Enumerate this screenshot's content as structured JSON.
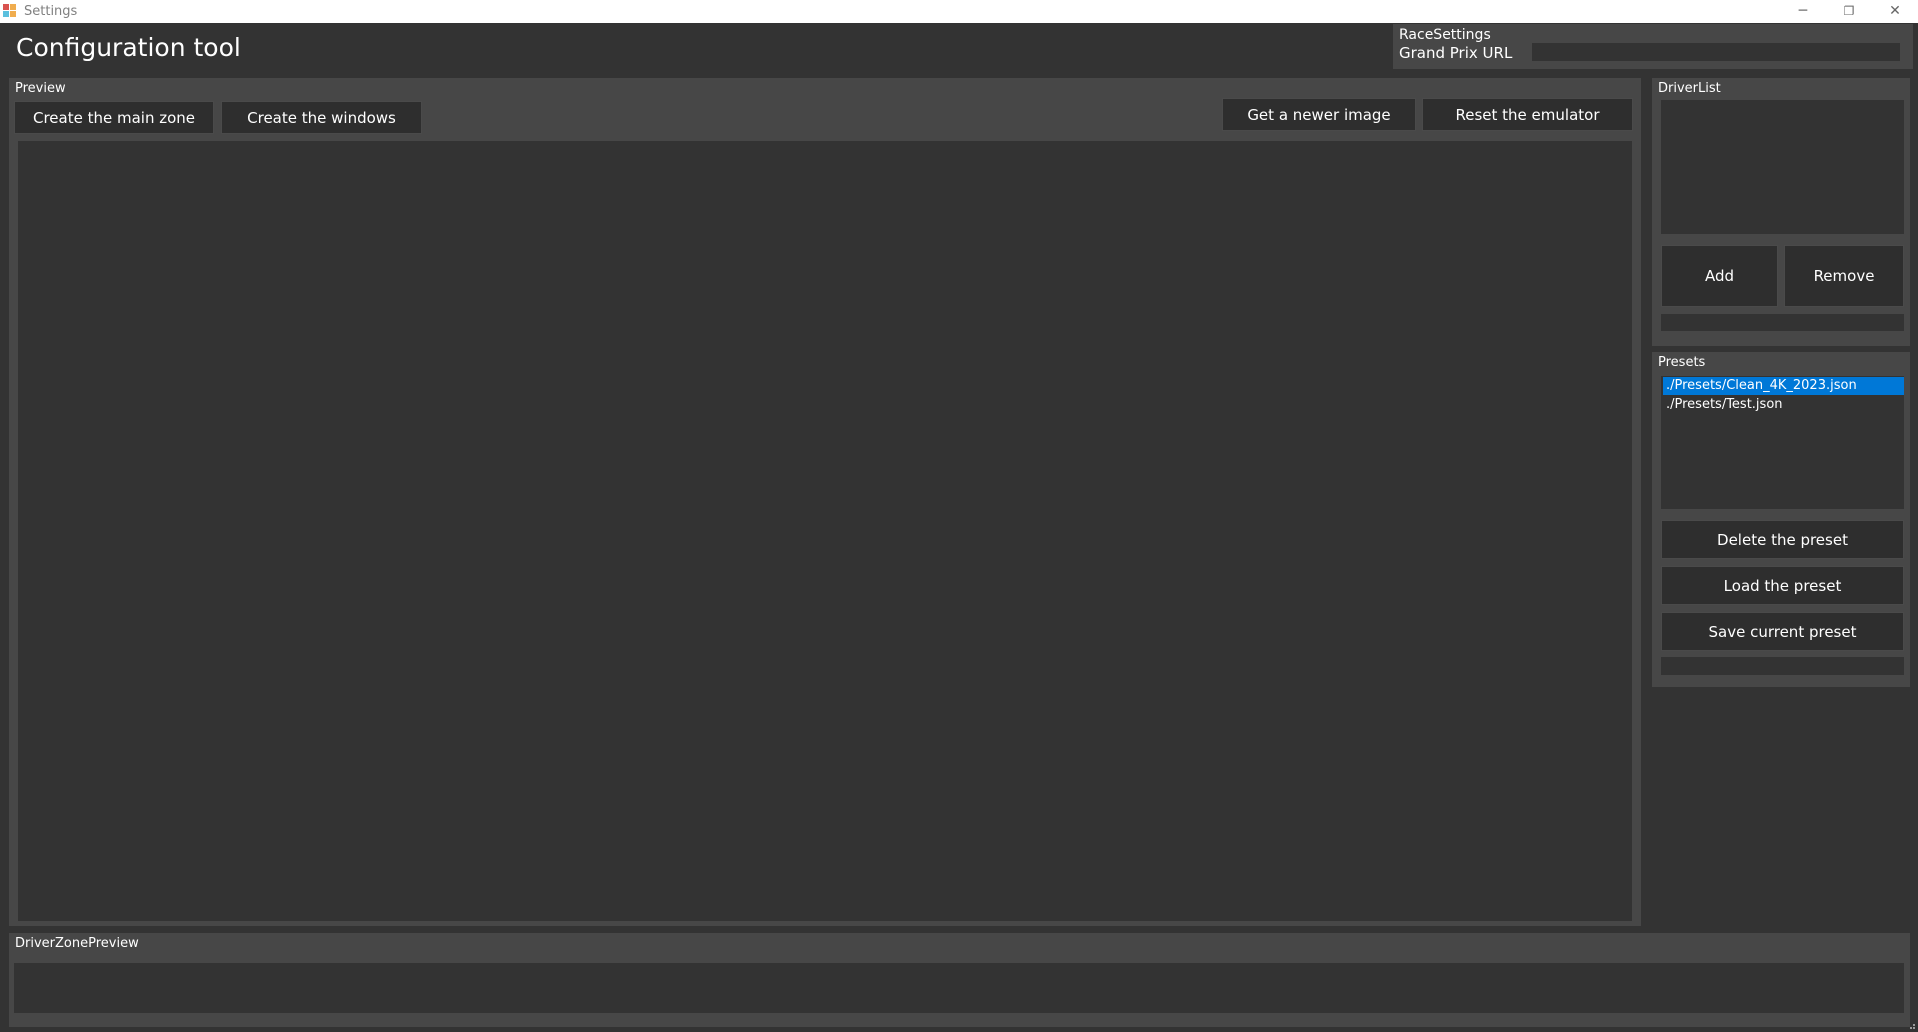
{
  "window": {
    "title": "Settings",
    "controls": {
      "minimize": "─",
      "restore": "❐",
      "close": "✕"
    }
  },
  "header": {
    "app_title": "Configuration tool"
  },
  "race_settings": {
    "group_label": "RaceSettings",
    "url_label": "Grand Prix URL",
    "url_value": ""
  },
  "preview": {
    "group_label": "Preview",
    "buttons": {
      "create_main_zone": "Create the main zone",
      "create_windows": "Create the windows",
      "get_newer_image": "Get a newer image",
      "reset_emulator": "Reset the emulator"
    }
  },
  "driver_list": {
    "group_label": "DriverList",
    "add_label": "Add",
    "remove_label": "Remove",
    "input_value": ""
  },
  "presets": {
    "group_label": "Presets",
    "items": [
      {
        "label": "./Presets/Clean_4K_2023.json",
        "selected": true
      },
      {
        "label": "./Presets/Test.json",
        "selected": false
      }
    ],
    "delete_label": "Delete the preset",
    "load_label": "Load the preset",
    "save_label": "Save current preset",
    "input_value": ""
  },
  "driver_zone_preview": {
    "group_label": "DriverZonePreview"
  },
  "colors": {
    "background": "#333333",
    "panel": "#474747",
    "button": "#2e2e2e",
    "selection": "#0078d7"
  }
}
